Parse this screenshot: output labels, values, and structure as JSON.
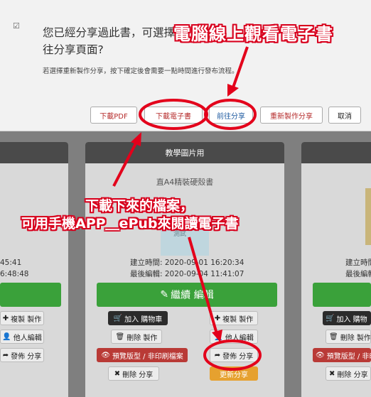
{
  "modal": {
    "check_icon": "☑",
    "title_line1": "您已經分享過此書，可選擇",
    "title_line2": "往分享頁面?",
    "description": "若選擇重新製作分享，按下確定後會需要一點時間進行發布流程。",
    "buttons": {
      "pdf": "下載PDF",
      "download_ebook": "下載電子書",
      "go_share": "前往分享",
      "reshare": "重新製作分享",
      "cancel": "取消"
    }
  },
  "annotations": {
    "top": "電腦線上觀看電子書",
    "mid_line1": "下載下來的檔案，",
    "mid_line2": "可用手機APP＿ePub來閱讀電子書"
  },
  "left_card": {
    "time1": "45:41",
    "time2": "6:48:48"
  },
  "center_card": {
    "header": "教學圖片用",
    "subtitle": "直A4精裝硬殼書",
    "thumb_caption": "測試",
    "created": "建立時間: 2020-09-01 16:20:34",
    "edited": "最後編輯: 2020-09-04 11:41:07",
    "continue_edit": "繼續 編輯",
    "add_cart": "加入 購物車",
    "delete_make": "刪除 製作",
    "preview": "預覽版型 / 非印刷檔案",
    "delete_share": "刪除 分享",
    "copy_make": "複製 製作",
    "others_edit": "他人編輯",
    "publish_share": "發佈 分享",
    "bottom_orange": "更新分享"
  },
  "left_buttons": {
    "copy_make": "複製 製作",
    "others_edit": "他人編輯",
    "publish_share": "發佈 分享"
  },
  "right_card": {
    "created": "建立時間",
    "edited": "最後編輯",
    "add_cart": "加入 購物",
    "delete_make": "刪除 製作",
    "preview": "預覽版型 / 非印",
    "delete_share": "刪除 分享"
  }
}
